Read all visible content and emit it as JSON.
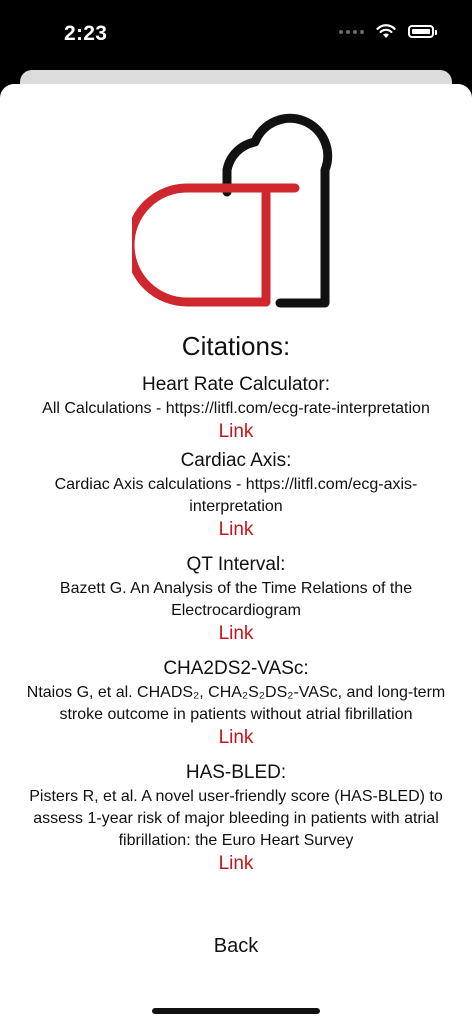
{
  "status_bar": {
    "time": "2:23"
  },
  "title": "Citations:",
  "sections": [
    {
      "heading": "Heart Rate Calculator:",
      "body": "All Calculations - https://litfl.com/ecg-rate-interpretation",
      "link": "Link"
    },
    {
      "heading": "Cardiac Axis:",
      "body": "Cardiac Axis calculations - https://litfl.com/ecg-axis-interpretation",
      "link": "Link"
    },
    {
      "heading": "QT Interval:",
      "body": "Bazett G. An Analysis of the Time Relations of the Electrocardiogram",
      "link": "Link"
    },
    {
      "heading": "CHA2DS2-VASc:",
      "body": "Ntaios G, et al. CHADS₂, CHA₂S₂DS₂-VASc, and long-term stroke outcome in patients without atrial fibrillation",
      "link": "Link"
    },
    {
      "heading": "HAS-BLED:",
      "body": "Pisters R, et al. A novel user-friendly score (HAS-BLED) to assess 1-year risk of major bleeding in patients with atrial fibrillation: the Euro Heart Survey",
      "link": "Link"
    }
  ],
  "back_label": "Back",
  "colors": {
    "accent_red": "#d0262e",
    "link_red": "#c4161c",
    "logo_black": "#111111"
  },
  "icons": {
    "wifi": "wifi-icon",
    "battery": "battery-icon",
    "logo": "app-logo-icon"
  }
}
